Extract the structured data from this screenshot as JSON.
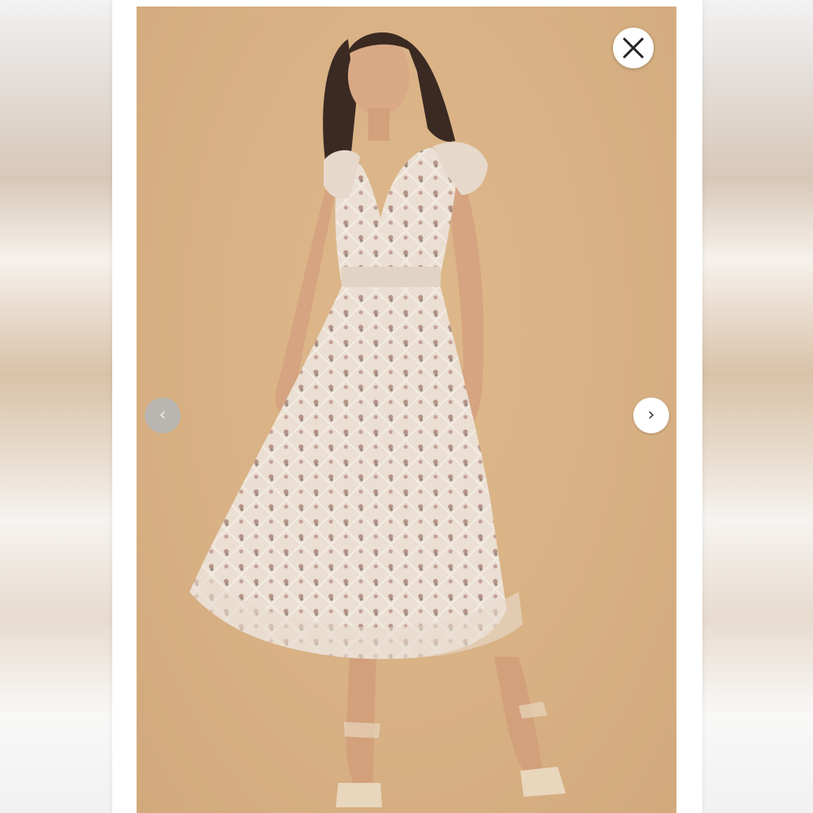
{
  "viewer": {
    "close_icon": "close-icon",
    "prev_glyph": "‹",
    "next_glyph": "›",
    "prev_icon": "chevron-left-icon",
    "next_icon": "chevron-right-icon"
  },
  "image": {
    "subject": "product-photo",
    "background_color": "#d9b386",
    "dress_color": "#e9dccd"
  }
}
